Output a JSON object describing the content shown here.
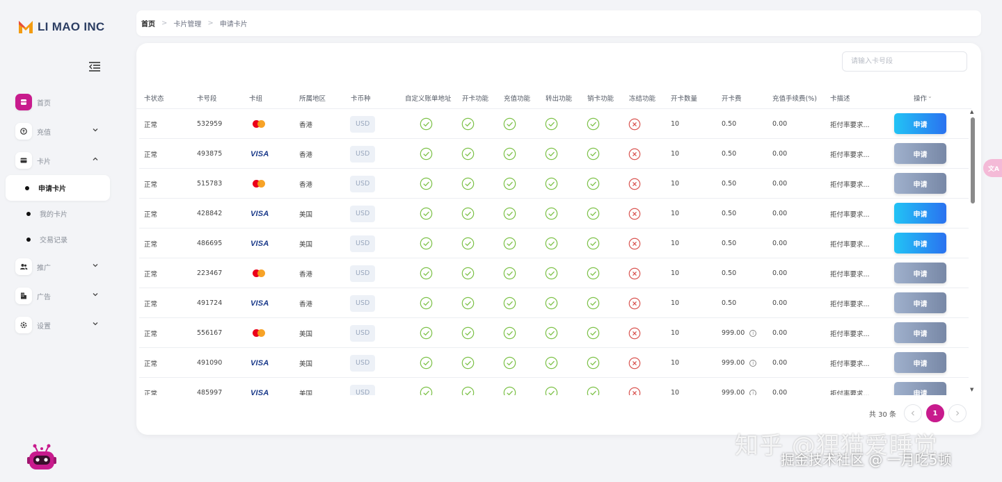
{
  "brand": {
    "name": "LI MAO INC"
  },
  "sidebar": {
    "items": [
      {
        "label": "首页",
        "icon": "home-icon",
        "active": true,
        "expandable": false
      },
      {
        "label": "充值",
        "icon": "recharge-icon",
        "expandable": true,
        "caret": "down"
      },
      {
        "label": "卡片",
        "icon": "card-icon",
        "expandable": true,
        "caret": "up"
      },
      {
        "label": "推广",
        "icon": "users-icon",
        "expandable": true,
        "caret": "down"
      },
      {
        "label": "广告",
        "icon": "ad-icon",
        "expandable": true,
        "caret": "down"
      },
      {
        "label": "设置",
        "icon": "gear-icon",
        "expandable": true,
        "caret": "down"
      }
    ],
    "card_subitems": [
      {
        "label": "申请卡片",
        "active": true
      },
      {
        "label": "我的卡片",
        "active": false
      },
      {
        "label": "交易记录",
        "active": false
      }
    ]
  },
  "breadcrumb": {
    "items": [
      "首页",
      "卡片管理",
      "申请卡片"
    ]
  },
  "search": {
    "placeholder": "请输入卡号段"
  },
  "table": {
    "headers": [
      "卡状态",
      "卡号段",
      "卡组",
      "所属地区",
      "卡币种",
      "自定义账单地址",
      "开卡功能",
      "充值功能",
      "转出功能",
      "销卡功能",
      "冻结功能",
      "开卡数量",
      "开卡费",
      "充值手续费(%)",
      "卡描述",
      "操作"
    ],
    "rows": [
      {
        "status": "正常",
        "bin": "532959",
        "network": "mastercard",
        "region": "香港",
        "currency": "USD",
        "billing": true,
        "open": true,
        "recharge": true,
        "transfer": true,
        "cancel": true,
        "freeze": false,
        "qty": "10",
        "fee": "0.50",
        "fee_info": false,
        "rate": "0.00",
        "desc": "拒付率要求...",
        "action": "申请",
        "action_style": "blue"
      },
      {
        "status": "正常",
        "bin": "493875",
        "network": "visa",
        "region": "香港",
        "currency": "USD",
        "billing": true,
        "open": true,
        "recharge": true,
        "transfer": true,
        "cancel": true,
        "freeze": false,
        "qty": "10",
        "fee": "0.50",
        "fee_info": false,
        "rate": "0.00",
        "desc": "拒付率要求...",
        "action": "申请",
        "action_style": "gray"
      },
      {
        "status": "正常",
        "bin": "515783",
        "network": "mastercard",
        "region": "香港",
        "currency": "USD",
        "billing": true,
        "open": true,
        "recharge": true,
        "transfer": true,
        "cancel": true,
        "freeze": false,
        "qty": "10",
        "fee": "0.50",
        "fee_info": false,
        "rate": "0.00",
        "desc": "拒付率要求...",
        "action": "申请",
        "action_style": "gray"
      },
      {
        "status": "正常",
        "bin": "428842",
        "network": "visa",
        "region": "美国",
        "currency": "USD",
        "billing": true,
        "open": true,
        "recharge": true,
        "transfer": true,
        "cancel": true,
        "freeze": false,
        "qty": "10",
        "fee": "0.50",
        "fee_info": false,
        "rate": "0.00",
        "desc": "拒付率要求...",
        "action": "申请",
        "action_style": "blue"
      },
      {
        "status": "正常",
        "bin": "486695",
        "network": "visa",
        "region": "美国",
        "currency": "USD",
        "billing": true,
        "open": true,
        "recharge": true,
        "transfer": true,
        "cancel": true,
        "freeze": false,
        "qty": "10",
        "fee": "0.50",
        "fee_info": false,
        "rate": "0.00",
        "desc": "拒付率要求...",
        "action": "申请",
        "action_style": "blue"
      },
      {
        "status": "正常",
        "bin": "223467",
        "network": "mastercard",
        "region": "香港",
        "currency": "USD",
        "billing": true,
        "open": true,
        "recharge": true,
        "transfer": true,
        "cancel": true,
        "freeze": false,
        "qty": "10",
        "fee": "0.50",
        "fee_info": false,
        "rate": "0.00",
        "desc": "拒付率要求...",
        "action": "申请",
        "action_style": "gray"
      },
      {
        "status": "正常",
        "bin": "491724",
        "network": "visa",
        "region": "香港",
        "currency": "USD",
        "billing": true,
        "open": true,
        "recharge": true,
        "transfer": true,
        "cancel": true,
        "freeze": false,
        "qty": "10",
        "fee": "0.50",
        "fee_info": false,
        "rate": "0.00",
        "desc": "拒付率要求...",
        "action": "申请",
        "action_style": "gray"
      },
      {
        "status": "正常",
        "bin": "556167",
        "network": "mastercard",
        "region": "美国",
        "currency": "USD",
        "billing": true,
        "open": true,
        "recharge": true,
        "transfer": true,
        "cancel": true,
        "freeze": false,
        "qty": "10",
        "fee": "999.00",
        "fee_info": true,
        "rate": "0.00",
        "desc": "拒付率要求...",
        "action": "申请",
        "action_style": "gray"
      },
      {
        "status": "正常",
        "bin": "491090",
        "network": "visa",
        "region": "美国",
        "currency": "USD",
        "billing": true,
        "open": true,
        "recharge": true,
        "transfer": true,
        "cancel": true,
        "freeze": false,
        "qty": "10",
        "fee": "999.00",
        "fee_info": true,
        "rate": "0.00",
        "desc": "拒付率要求...",
        "action": "申请",
        "action_style": "gray"
      },
      {
        "status": "正常",
        "bin": "485997",
        "network": "visa",
        "region": "美国",
        "currency": "USD",
        "billing": true,
        "open": true,
        "recharge": true,
        "transfer": true,
        "cancel": true,
        "freeze": false,
        "qty": "10",
        "fee": "999.00",
        "fee_info": true,
        "rate": "0.00",
        "desc": "拒付率要求...",
        "action": "申请",
        "action_style": "gray"
      }
    ]
  },
  "pagination": {
    "total_label": "共 30 条",
    "current_page": "1"
  },
  "float_button": {
    "label": "文A"
  },
  "watermark": {
    "line1": "知乎 @狸猫爱睡觉",
    "line2": "掘金技术社区 @ 一月吃5顿"
  },
  "colors": {
    "accent": "#c81b8d",
    "ok": "#7ec24a",
    "no": "#d9534f",
    "apply_blue": "#2a72f0",
    "apply_gray": "#8393b2"
  }
}
